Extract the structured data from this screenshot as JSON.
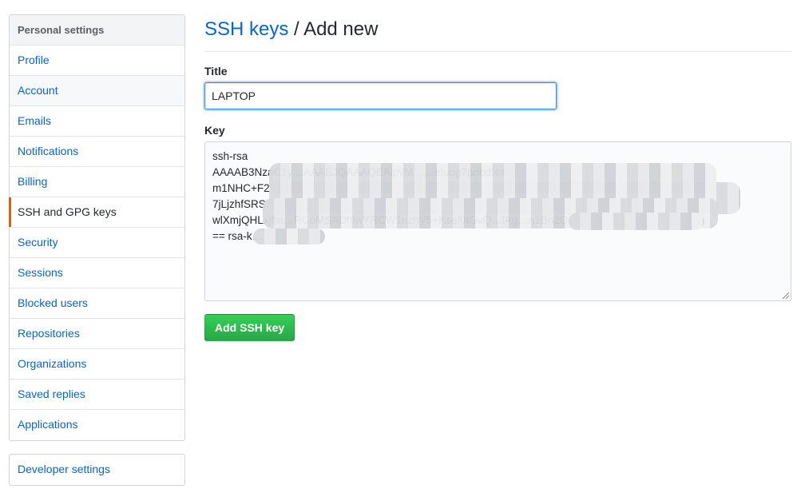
{
  "sidebar": {
    "heading": "Personal settings",
    "items": [
      {
        "label": "Profile"
      },
      {
        "label": "Account"
      },
      {
        "label": "Emails"
      },
      {
        "label": "Notifications"
      },
      {
        "label": "Billing"
      },
      {
        "label": "SSH and GPG keys",
        "selected": true
      },
      {
        "label": "Security"
      },
      {
        "label": "Sessions"
      },
      {
        "label": "Blocked users"
      },
      {
        "label": "Repositories"
      },
      {
        "label": "Organizations"
      },
      {
        "label": "Saved replies"
      },
      {
        "label": "Applications"
      }
    ],
    "developer_settings": "Developer settings",
    "accent_color": "#e36209"
  },
  "header": {
    "breadcrumb_link": "SSH keys",
    "separator": " / ",
    "title": "Add new"
  },
  "form": {
    "title_label": "Title",
    "title_value": "LAPTOP",
    "key_label": "Key",
    "key_lines": [
      "ssh-rsa",
      "AAAAB3NzaC1y…AAABJQAAAQEAlpvM……eluog7pnbdNa",
      "m1NHC+F2V+x5cx……+zXJRV8HEp",
      "7jLjzhfSRS……oJ8aNG9",
      "wlXmjQHLxjfm…RCoMSADhlwYRCW1nznV5+Kse/0tGvQ…lAg…n1Bn2Q6Q",
      "== rsa-k…"
    ],
    "key_redacted": true,
    "submit_label": "Add SSH key"
  }
}
